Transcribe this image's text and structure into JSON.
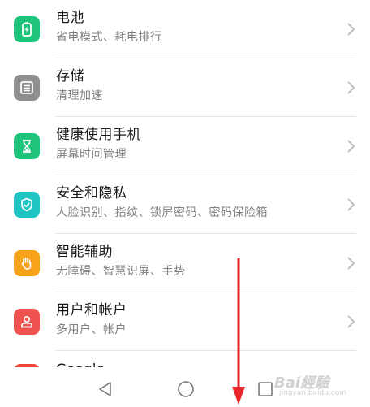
{
  "settings": {
    "items": [
      {
        "title": "电池",
        "subtitle": "省电模式、耗电排行",
        "icon": "battery-icon",
        "color": "#1ec47b"
      },
      {
        "title": "存储",
        "subtitle": "清理加速",
        "icon": "storage-icon",
        "color": "#8f8f8f"
      },
      {
        "title": "健康使用手机",
        "subtitle": "屏幕时间管理",
        "icon": "hourglass-icon",
        "color": "#1ec47b"
      },
      {
        "title": "安全和隐私",
        "subtitle": "人脸识别、指纹、锁屏密码、密码保险箱",
        "icon": "shield-icon",
        "color": "#1fc4c4"
      },
      {
        "title": "智能辅助",
        "subtitle": "无障碍、智慧识屏、手势",
        "icon": "hand-icon",
        "color": "#f7a21b"
      },
      {
        "title": "用户和帐户",
        "subtitle": "多用户、帐户",
        "icon": "user-icon",
        "color": "#ef5350"
      }
    ],
    "partial_item": {
      "title": "Google"
    }
  },
  "navbar": {
    "back": "back-triangle-icon",
    "home": "home-circle-icon",
    "recents": "recents-square-icon"
  },
  "overlay": {
    "arrow_color": "#e8262b",
    "watermark_main": "Bai經驗",
    "watermark_sub": "jingyan.baidu.com"
  }
}
